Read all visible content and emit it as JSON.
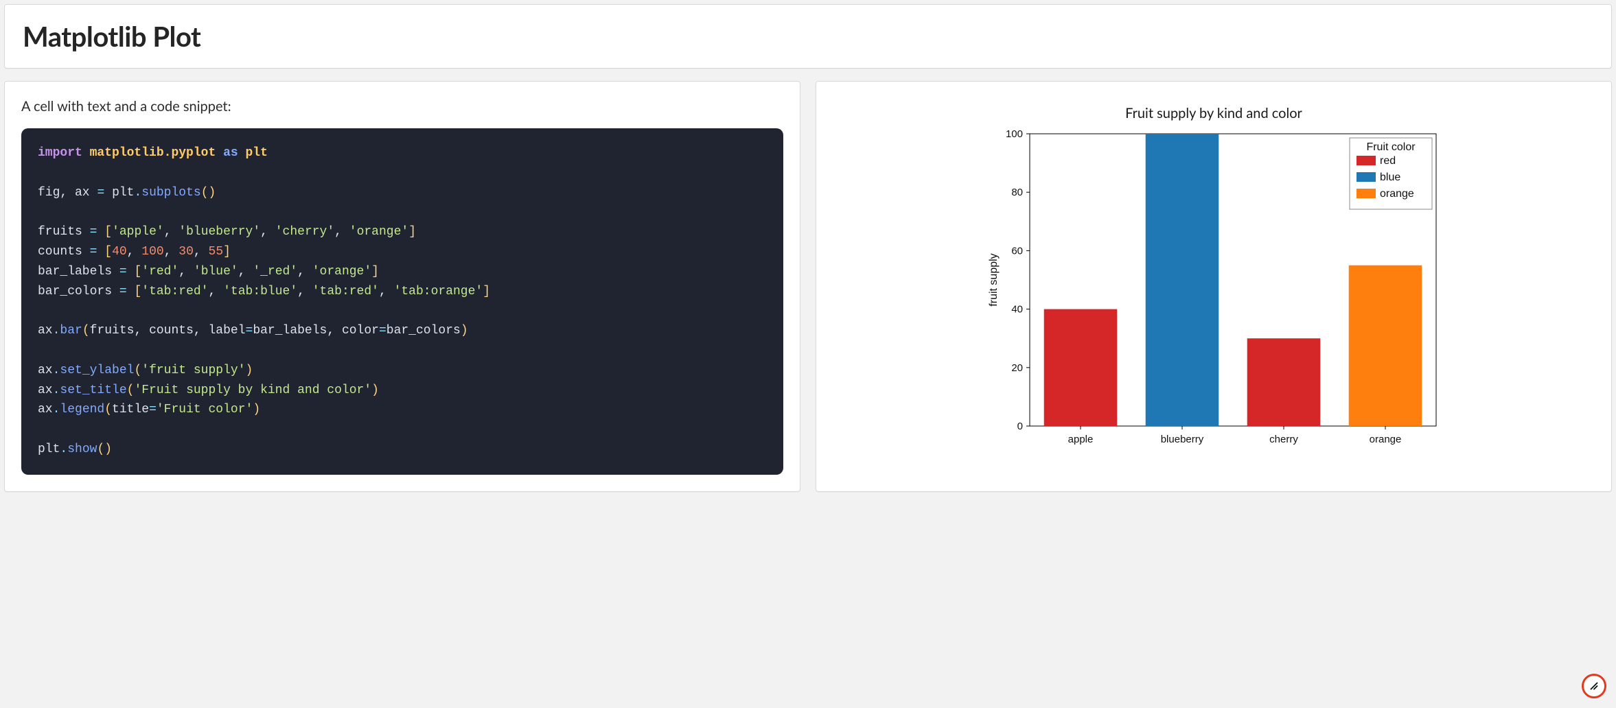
{
  "header": {
    "title": "Matplotlib Plot"
  },
  "left": {
    "intro": "A cell with text and a code snippet:",
    "code": {
      "l1": {
        "import": "import",
        "module": "matplotlib.pyplot",
        "as": "as",
        "alias": "plt"
      },
      "l2": "",
      "l3": {
        "lhs": "fig, ax",
        "eq": "=",
        "obj": "plt",
        "dot": ".",
        "fn": "subplots",
        "par": "()"
      },
      "l4": "",
      "l5": {
        "var": "fruits",
        "eq": "=",
        "open": "[",
        "a": "'apple'",
        "b": "'blueberry'",
        "c": "'cherry'",
        "d": "'orange'",
        "close": "]"
      },
      "l6": {
        "var": "counts",
        "eq": "=",
        "open": "[",
        "a": "40",
        "b": "100",
        "c": "30",
        "d": "55",
        "close": "]"
      },
      "l7": {
        "var": "bar_labels",
        "eq": "=",
        "open": "[",
        "a": "'red'",
        "b": "'blue'",
        "c": "'_red'",
        "d": "'orange'",
        "close": "]"
      },
      "l8": {
        "var": "bar_colors",
        "eq": "=",
        "open": "[",
        "a": "'tab:red'",
        "b": "'tab:blue'",
        "c": "'tab:red'",
        "d": "'tab:orange'",
        "close": "]"
      },
      "l9": "",
      "l10": {
        "obj": "ax",
        "dot": ".",
        "fn": "bar",
        "arg1": "fruits",
        "arg2": "counts",
        "kw1": "label",
        "eq1": "=",
        "val1": "bar_labels",
        "kw2": "color",
        "eq2": "=",
        "val2": "bar_colors"
      },
      "l11": "",
      "l12": {
        "obj": "ax",
        "dot": ".",
        "fn": "set_ylabel",
        "arg": "'fruit supply'"
      },
      "l13": {
        "obj": "ax",
        "dot": ".",
        "fn": "set_title",
        "arg": "'Fruit supply by kind and color'"
      },
      "l14": {
        "obj": "ax",
        "dot": ".",
        "fn": "legend",
        "kw": "title",
        "eq": "=",
        "val": "'Fruit color'"
      },
      "l15": "",
      "l16": {
        "obj": "plt",
        "dot": ".",
        "fn": "show",
        "par": "()"
      }
    }
  },
  "chart_data": {
    "type": "bar",
    "title": "Fruit supply by kind and color",
    "ylabel": "fruit supply",
    "xlabel": "",
    "categories": [
      "apple",
      "blueberry",
      "cherry",
      "orange"
    ],
    "values": [
      40,
      100,
      30,
      55
    ],
    "colors": [
      "#d62728",
      "#1f77b4",
      "#d62728",
      "#ff7f0e"
    ],
    "yticks": [
      0,
      20,
      40,
      60,
      80,
      100
    ],
    "ylim": [
      0,
      100
    ],
    "legend": {
      "title": "Fruit color",
      "items": [
        {
          "label": "red",
          "color": "#d62728"
        },
        {
          "label": "blue",
          "color": "#1f77b4"
        },
        {
          "label": "orange",
          "color": "#ff7f0e"
        }
      ]
    }
  }
}
